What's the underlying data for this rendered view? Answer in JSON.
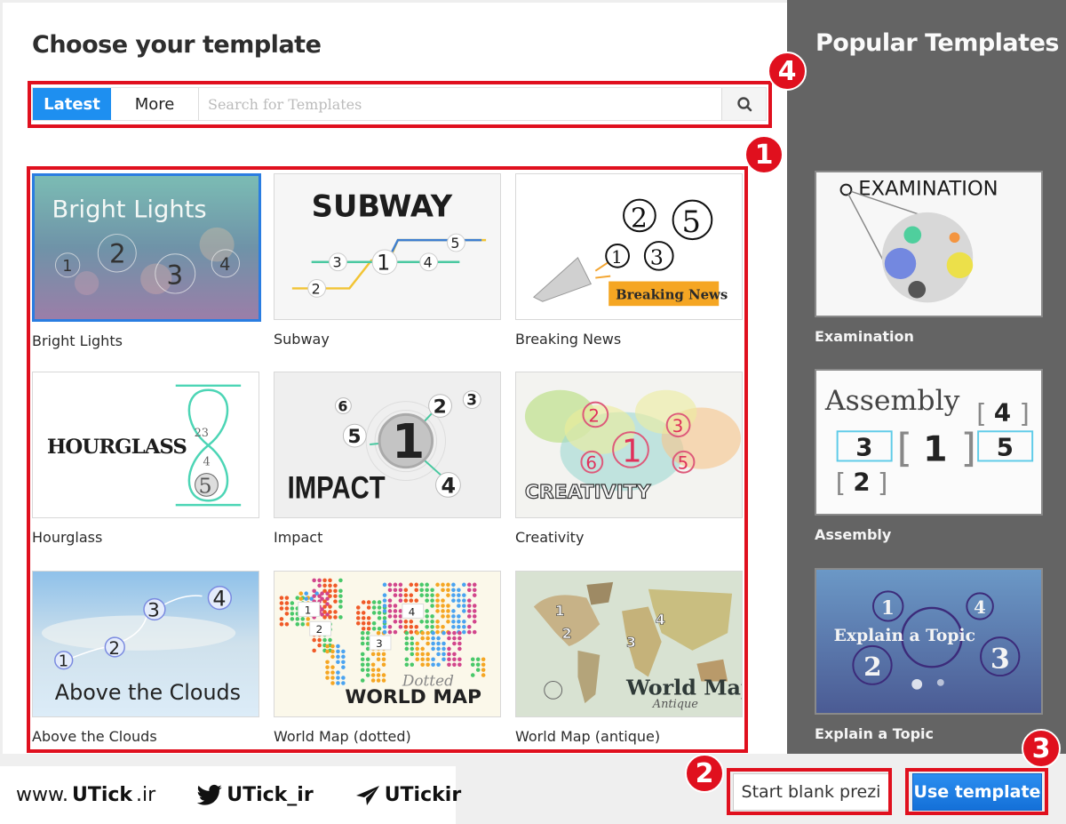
{
  "main": {
    "title": "Choose your template",
    "tabs": [
      {
        "label": "Latest",
        "active": true
      },
      {
        "label": "More",
        "active": false
      }
    ],
    "search": {
      "placeholder": "Search for Templates",
      "value": ""
    },
    "templates": [
      {
        "label": "Bright Lights",
        "thumb_text": "Bright Lights",
        "selected": true
      },
      {
        "label": "Subway",
        "thumb_text": "SUBWAY",
        "selected": false
      },
      {
        "label": "Breaking News",
        "thumb_text": "Breaking News",
        "selected": false
      },
      {
        "label": "Hourglass",
        "thumb_text": "HOURGLASS",
        "selected": false
      },
      {
        "label": "Impact",
        "thumb_text": "IMPACT",
        "selected": false
      },
      {
        "label": "Creativity",
        "thumb_text": "CREATIVITY",
        "selected": false
      },
      {
        "label": "Above the Clouds",
        "thumb_text": "Above the Clouds",
        "selected": false
      },
      {
        "label": "World Map (dotted)",
        "thumb_text": "WORLD MAP",
        "thumb_subtext": "Dotted",
        "selected": false
      },
      {
        "label": "World Map (antique)",
        "thumb_text": "World Map",
        "thumb_subtext": "Antique",
        "selected": false
      }
    ]
  },
  "sidebar": {
    "title": "Popular Templates",
    "templates": [
      {
        "label": "Examination",
        "thumb_text": "EXAMINATION"
      },
      {
        "label": "Assembly",
        "thumb_text": "Assembly"
      },
      {
        "label": "Explain a Topic",
        "thumb_text": "Explain a Topic"
      }
    ]
  },
  "footer": {
    "start_blank_label": "Start blank prezi",
    "use_template_label": "Use template"
  },
  "annotations": {
    "badge_1": "1",
    "badge_2": "2",
    "badge_3": "3",
    "badge_4": "4",
    "color": "#e0101e"
  },
  "watermark": {
    "website_prefix": "www.",
    "website_brand": "UTick",
    "website_suffix": ".ir",
    "twitter": "UTick_ir",
    "telegram": "UTickir"
  },
  "colors": {
    "accent": "#1e8ff0",
    "sidebar_bg": "#646464",
    "annotation_red": "#e0101e"
  }
}
